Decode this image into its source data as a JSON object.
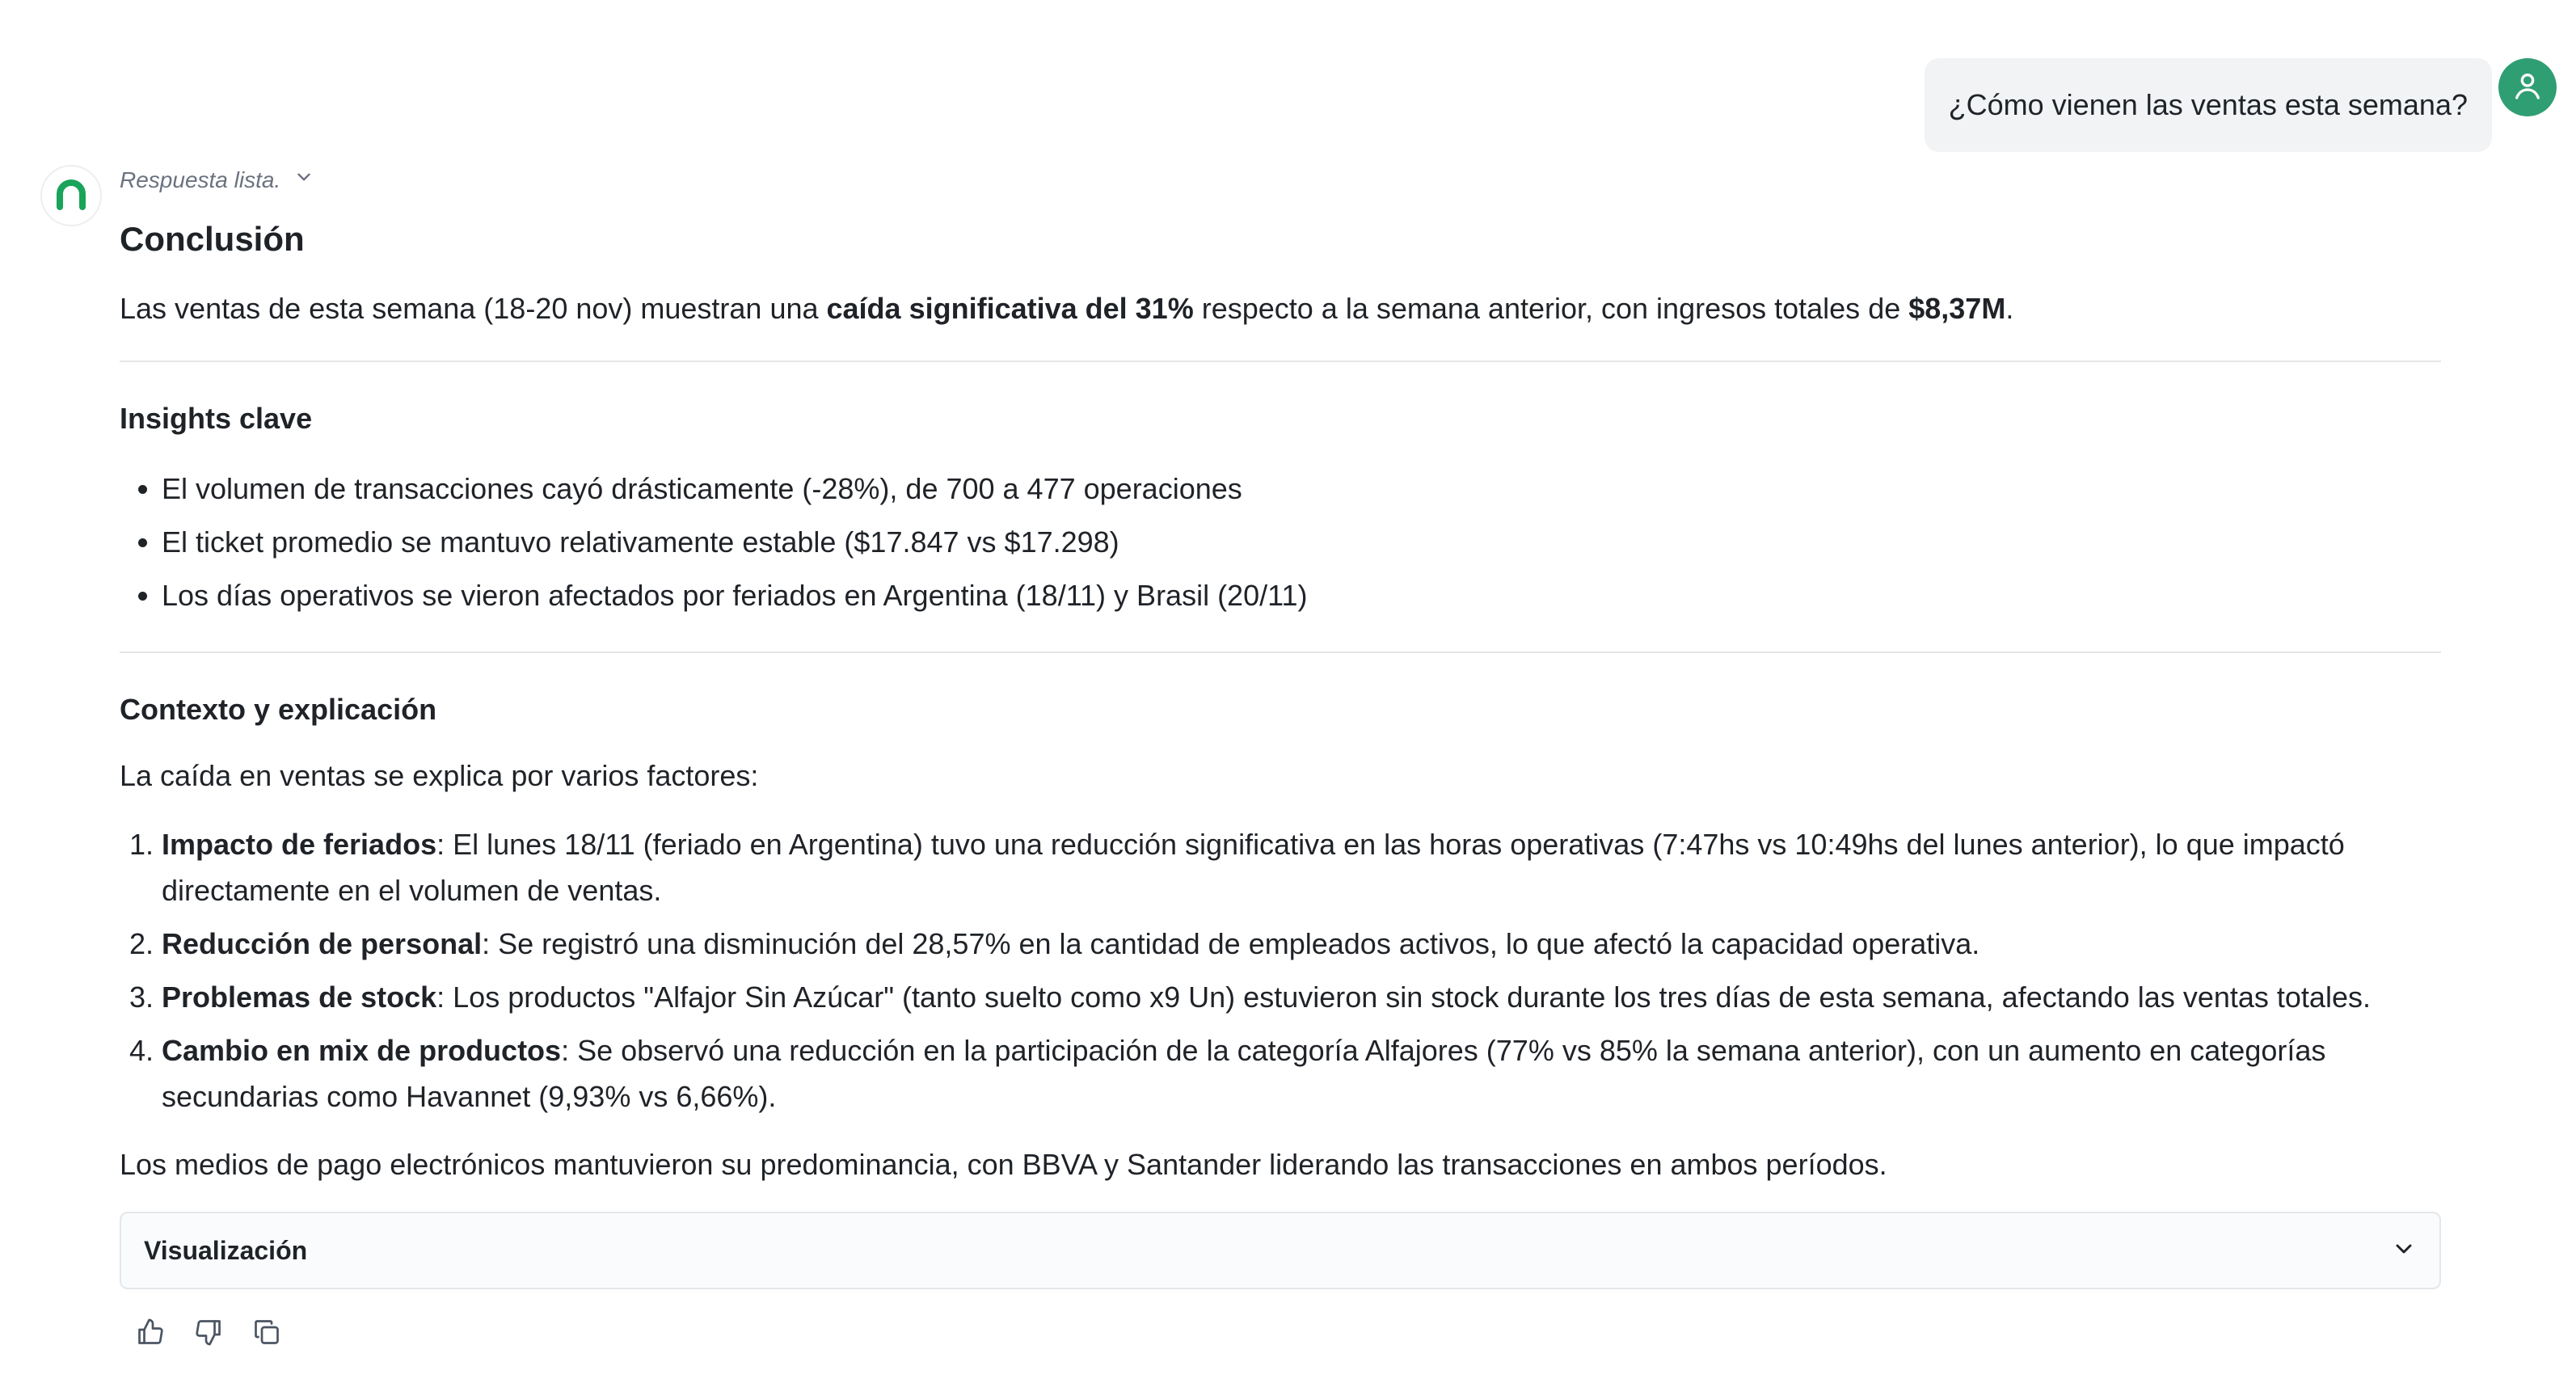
{
  "user_message": "¿Cómo vienen las ventas esta semana?",
  "status": "Respuesta lista.",
  "conclusion": {
    "title": "Conclusión",
    "text_1": "Las ventas de esta semana (18-20 nov) muestran una ",
    "bold_1": "caída significativa del 31%",
    "text_2": " respecto a la semana anterior, con ingresos totales de ",
    "bold_2": "$8,37M",
    "text_3": "."
  },
  "insights": {
    "title": "Insights clave",
    "items": [
      "El volumen de transacciones cayó drásticamente (-28%), de 700 a 477 operaciones",
      "El ticket promedio se mantuvo relativamente estable ($17.847 vs $17.298)",
      "Los días operativos se vieron afectados por feriados en Argentina (18/11) y Brasil (20/11)"
    ]
  },
  "context": {
    "title": "Contexto y explicación",
    "intro": "La caída en ventas se explica por varios factores:",
    "factors": [
      {
        "bold": "Impacto de feriados",
        "text": ": El lunes 18/11 (feriado en Argentina) tuvo una reducción significativa en las horas operativas (7:47hs vs 10:49hs del lunes anterior), lo que impactó directamente en el volumen de ventas."
      },
      {
        "bold": "Reducción de personal",
        "text": ": Se registró una disminución del 28,57% en la cantidad de empleados activos, lo que afectó la capacidad operativa."
      },
      {
        "bold": "Problemas de stock",
        "text": ": Los productos \"Alfajor Sin Azúcar\" (tanto suelto como x9 Un) estuvieron sin stock durante los tres días de esta semana, afectando las ventas totales."
      },
      {
        "bold": "Cambio en mix de productos",
        "text": ": Se observó una reducción en la participación de la categoría Alfajores (77% vs 85% la semana anterior), con un aumento en categorías secundarias como Havannet (9,93% vs 6,66%)."
      }
    ],
    "closing": "Los medios de pago electrónicos mantuvieron su predominancia, con BBVA y Santander liderando las transacciones en ambos períodos."
  },
  "visualization": {
    "label": "Visualización"
  },
  "icons": {
    "user_avatar": "user-icon",
    "bot_avatar": "brand-logo-icon",
    "status_toggle": "chevron-down-icon",
    "thumbs_up": "thumbs-up-icon",
    "thumbs_down": "thumbs-down-icon",
    "copy": "copy-icon"
  },
  "colors": {
    "accent": "#2f9e73",
    "user_bubble": "#f1f3f5",
    "logo": "#1aa35a"
  }
}
